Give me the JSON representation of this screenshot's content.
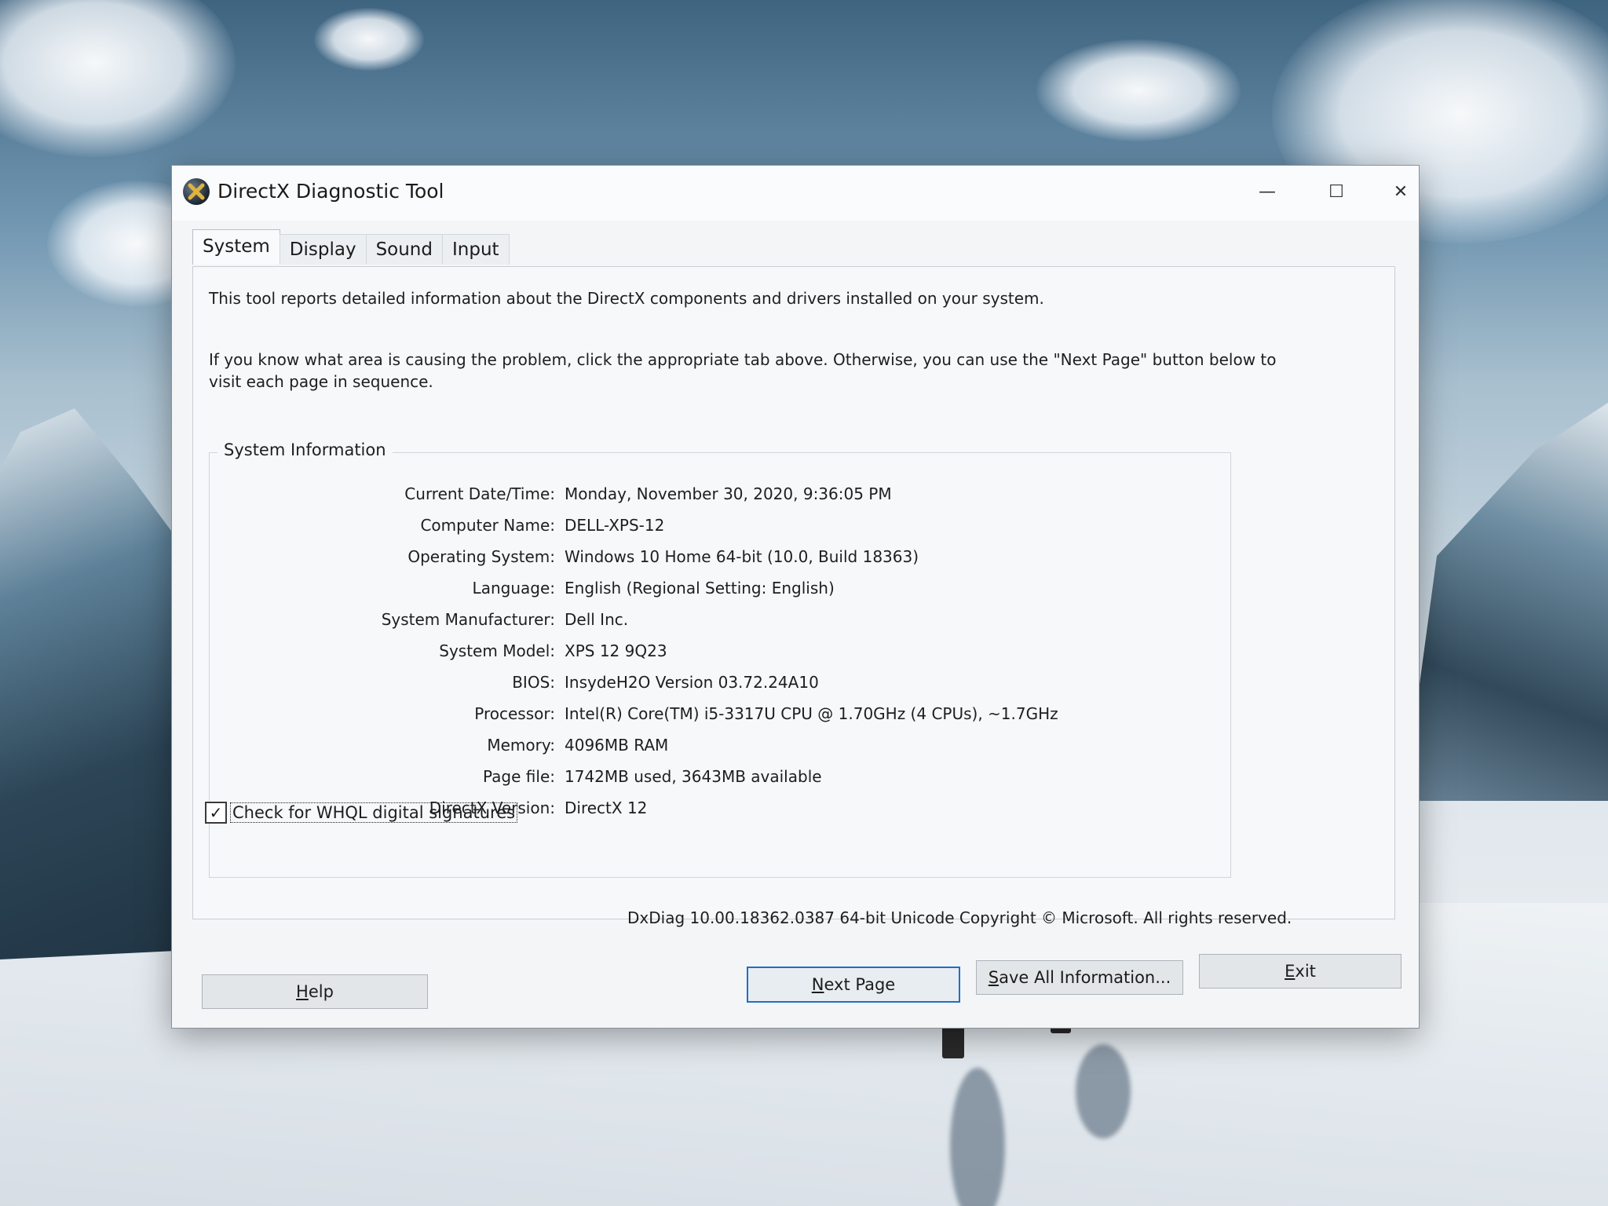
{
  "window": {
    "title": "DirectX Diagnostic Tool",
    "controls": {
      "minimize": "—",
      "maximize": "☐",
      "close": "✕"
    }
  },
  "tabs": [
    {
      "label": "System",
      "active": true
    },
    {
      "label": "Display",
      "active": false
    },
    {
      "label": "Sound",
      "active": false
    },
    {
      "label": "Input",
      "active": false
    }
  ],
  "intro": {
    "p1": "This tool reports detailed information about the DirectX components and drivers installed on your system.",
    "p2": "If you know what area is causing the problem, click the appropriate tab above.  Otherwise, you can use the \"Next Page\" button below to visit each page in sequence."
  },
  "system_info": {
    "legend": "System Information",
    "rows": [
      {
        "label": "Current Date/Time:",
        "value": "Monday, November 30, 2020, 9:36:05 PM"
      },
      {
        "label": "Computer Name:",
        "value": "DELL-XPS-12"
      },
      {
        "label": "Operating System:",
        "value": "Windows 10 Home 64-bit (10.0, Build 18363)"
      },
      {
        "label": "Language:",
        "value": "English (Regional Setting: English)"
      },
      {
        "label": "System Manufacturer:",
        "value": "Dell Inc."
      },
      {
        "label": "System Model:",
        "value": "XPS 12 9Q23"
      },
      {
        "label": "BIOS:",
        "value": "InsydeH2O Version 03.72.24A10"
      },
      {
        "label": "Processor:",
        "value": "Intel(R) Core(TM) i5-3317U CPU @ 1.70GHz (4 CPUs), ~1.7GHz"
      },
      {
        "label": "Memory:",
        "value": "4096MB RAM"
      },
      {
        "label": "Page file:",
        "value": "1742MB used, 3643MB available"
      },
      {
        "label": "DirectX Version:",
        "value": "DirectX 12"
      }
    ]
  },
  "whql": {
    "label": "Check for WHQL digital signatures",
    "checked": true,
    "check_glyph": "✓"
  },
  "footer": {
    "copyright": "DxDiag 10.00.18362.0387 64-bit Unicode  Copyright © Microsoft. All rights reserved."
  },
  "buttons": {
    "help": {
      "mnemonic": "H",
      "rest": "elp"
    },
    "next": {
      "mnemonic": "N",
      "rest": "ext Page"
    },
    "save": {
      "mnemonic": "S",
      "rest": "ave All Information..."
    },
    "exit": {
      "mnemonic": "E",
      "rest": "xit"
    }
  },
  "colors": {
    "focus_border": "#1f6fc9",
    "window_bg": "#f3f5f7"
  }
}
